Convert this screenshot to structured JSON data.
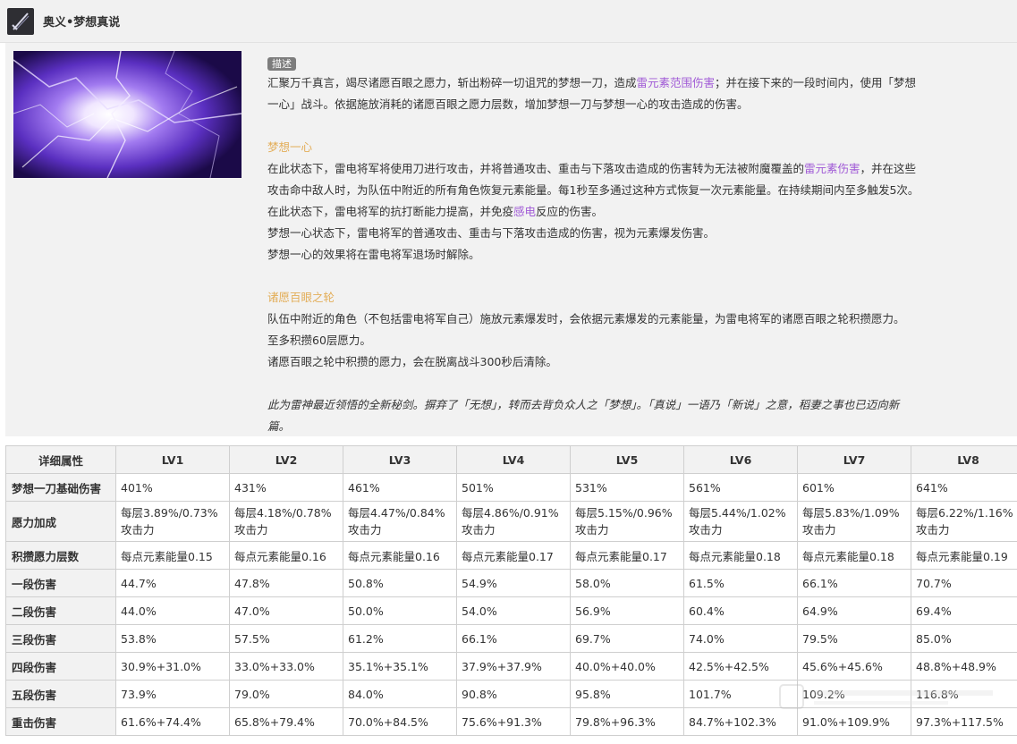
{
  "header": {
    "title": "奥义•梦想真说"
  },
  "description": {
    "tag": "描述",
    "intro_a": "汇聚万千真言，竭尽诸愿百眼之愿力，斩出粉碎一切诅咒的梦想一刀，造成",
    "intro_hl": "雷元素范围伤害",
    "intro_b": "；并在接下来的一段时间内，使用「梦想",
    "intro_c": "一心」战斗。依据施放消耗的诸愿百眼之愿力层数，增加梦想一刀与梦想一心的攻击造成的伤害。",
    "section1_title": "梦想一心",
    "s1_l1a": "在此状态下，雷电将军将使用刀进行攻击，并将普通攻击、重击与下落攻击造成的伤害转为无法被附魔覆盖的",
    "s1_l1hl": "雷元素伤害",
    "s1_l1b": "，并在这些",
    "s1_l2": "攻击命中敌人时，为队伍中附近的所有角色恢复元素能量。每1秒至多通过这种方式恢复一次元素能量。在持续期间内至多触发5次。",
    "s1_l3a": "在此状态下，雷电将军的抗打断能力提高，并免疫",
    "s1_l3hl": "感电",
    "s1_l3b": "反应的伤害。",
    "s1_l4": "梦想一心状态下，雷电将军的普通攻击、重击与下落攻击造成的伤害，视为元素爆发伤害。",
    "s1_l5": "梦想一心的效果将在雷电将军退场时解除。",
    "section2_title": "诸愿百眼之轮",
    "s2_l1": "队伍中附近的角色（不包括雷电将军自己）施放元素爆发时，会依据元素爆发的元素能量，为雷电将军的诸愿百眼之轮积攒愿力。",
    "s2_l2": "至多积攒60层愿力。",
    "s2_l3": "诸愿百眼之轮中积攒的愿力，会在脱离战斗300秒后清除。",
    "flavor_l1": "此为雷神最近领悟的全新秘剑。摒弃了「无想」，转而去背负众人之「梦想」。「真说」一语乃「新说」之意，稻妻之事也已迈向新",
    "flavor_l2": "篇。"
  },
  "table": {
    "headers": [
      "详细属性",
      "LV1",
      "LV2",
      "LV3",
      "LV4",
      "LV5",
      "LV6",
      "LV7",
      "LV8"
    ],
    "rows": [
      {
        "name": "梦想一刀基础伤害",
        "cells": [
          "401%",
          "431%",
          "461%",
          "501%",
          "531%",
          "561%",
          "601%",
          "641%"
        ]
      },
      {
        "name": "愿力加成",
        "cells": [
          "每层3.89%/0.73%",
          "每层4.18%/0.78%",
          "每层4.47%/0.84%",
          "每层4.86%/0.91%",
          "每层5.15%/0.96%",
          "每层5.44%/1.02%",
          "每层5.83%/1.09%",
          "每层6.22%/1.16%"
        ],
        "cells2": [
          "攻击力",
          "攻击力",
          "攻击力",
          "攻击力",
          "攻击力",
          "攻击力",
          "攻击力",
          "攻击力"
        ]
      },
      {
        "name": "积攒愿力层数",
        "cells": [
          "每点元素能量0.15",
          "每点元素能量0.16",
          "每点元素能量0.16",
          "每点元素能量0.17",
          "每点元素能量0.17",
          "每点元素能量0.18",
          "每点元素能量0.18",
          "每点元素能量0.19"
        ]
      },
      {
        "name": "一段伤害",
        "cells": [
          "44.7%",
          "47.8%",
          "50.8%",
          "54.9%",
          "58.0%",
          "61.5%",
          "66.1%",
          "70.7%"
        ]
      },
      {
        "name": "二段伤害",
        "cells": [
          "44.0%",
          "47.0%",
          "50.0%",
          "54.0%",
          "56.9%",
          "60.4%",
          "64.9%",
          "69.4%"
        ]
      },
      {
        "name": "三段伤害",
        "cells": [
          "53.8%",
          "57.5%",
          "61.2%",
          "66.1%",
          "69.7%",
          "74.0%",
          "79.5%",
          "85.0%"
        ]
      },
      {
        "name": "四段伤害",
        "cells": [
          "30.9%+31.0%",
          "33.0%+33.0%",
          "35.1%+35.1%",
          "37.9%+37.9%",
          "40.0%+40.0%",
          "42.5%+42.5%",
          "45.6%+45.6%",
          "48.8%+48.9%"
        ]
      },
      {
        "name": "五段伤害",
        "cells": [
          "73.9%",
          "79.0%",
          "84.0%",
          "90.8%",
          "95.8%",
          "101.7%",
          "109.2%",
          "116.8%"
        ]
      },
      {
        "name": "重击伤害",
        "cells": [
          "61.6%+74.4%",
          "65.8%+79.4%",
          "70.0%+84.5%",
          "75.6%+91.3%",
          "79.8%+96.3%",
          "84.7%+102.3%",
          "91.0%+109.9%",
          "97.3%+117.5%"
        ]
      }
    ]
  },
  "colors": {
    "subtitle": "#e3ae59",
    "electro": "#a05ad6",
    "panel_bg": "#f2f2f2"
  }
}
